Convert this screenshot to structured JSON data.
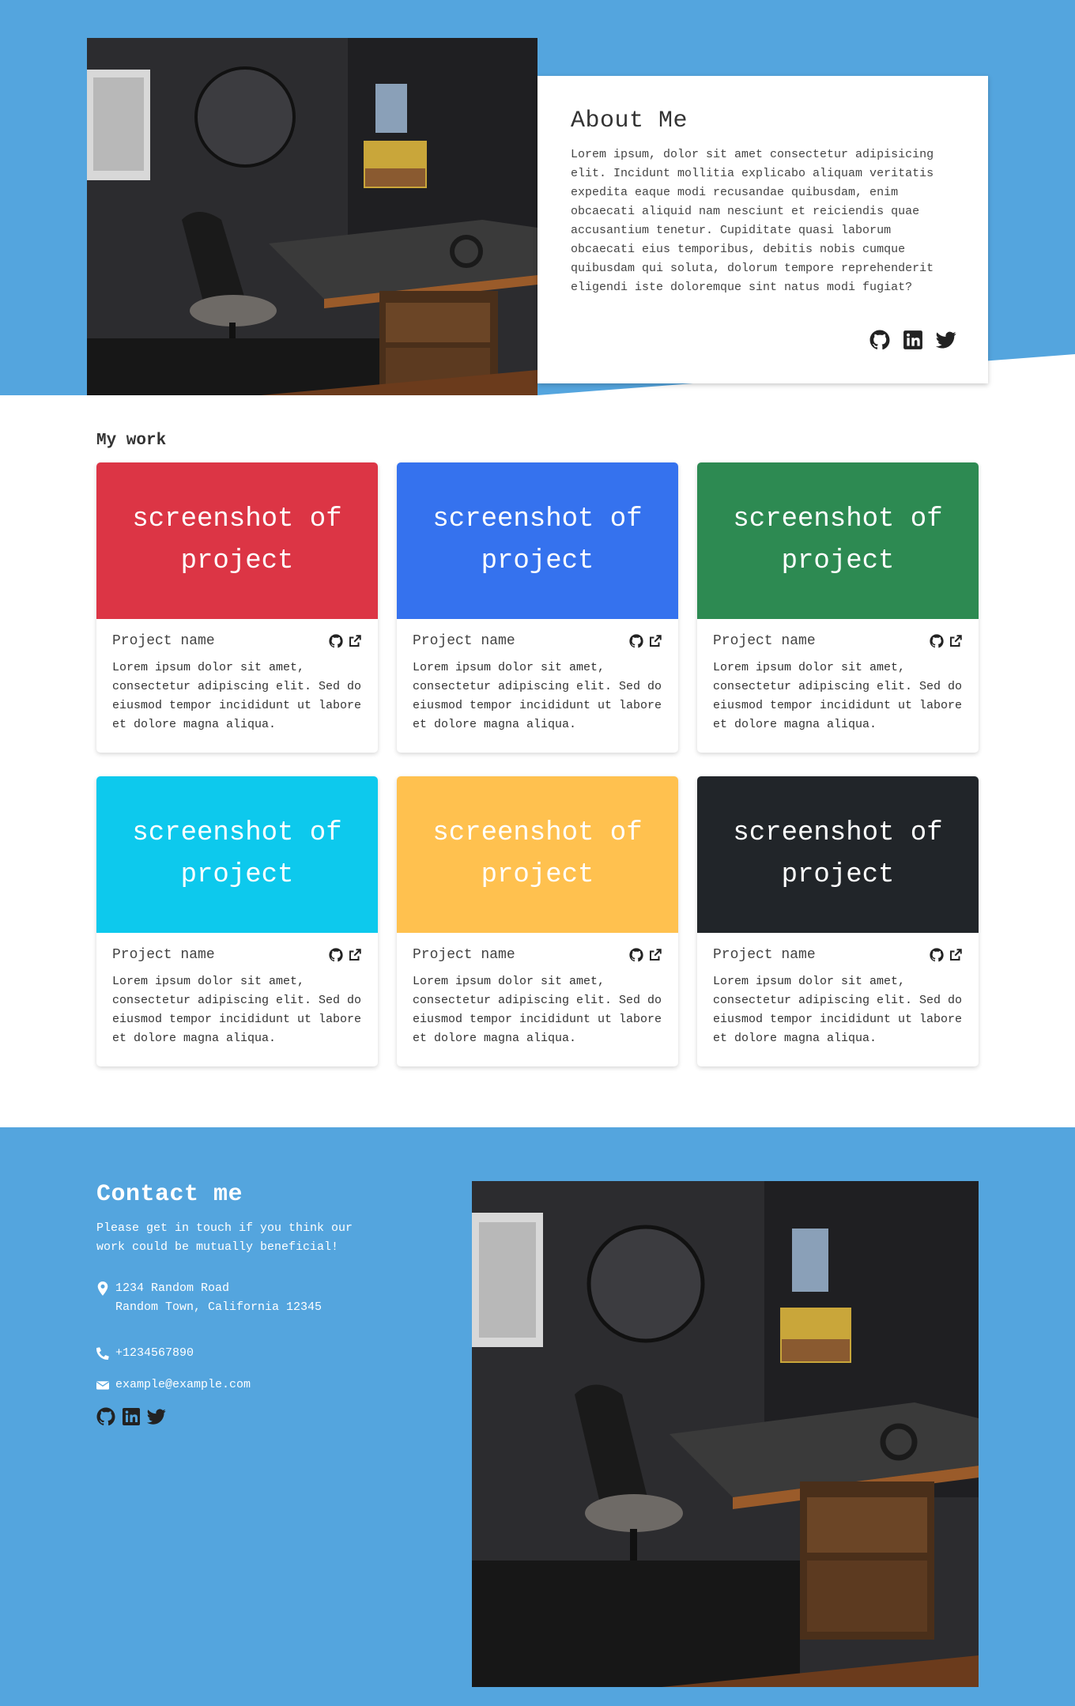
{
  "colors": {
    "hero_blue": "#54a5de",
    "card_red": "#dc3545",
    "card_blue": "#3572ee",
    "card_green": "#2d8a52",
    "card_cyan": "#0dc9ed",
    "card_yellow": "#ffc14f",
    "card_dark": "#212529"
  },
  "about": {
    "title": "About Me",
    "text": "Lorem ipsum, dolor sit amet consectetur adipisicing elit. Incidunt mollitia explicabo aliquam veritatis expedita eaque modi recusandae quibusdam, enim obcaecati aliquid nam nesciunt et reiciendis quae accusantium tenetur. Cupiditate quasi laborum obcaecati eius temporibus, debitis nobis cumque quibusdam qui soluta, dolorum tempore reprehenderit eligendi iste doloremque sint natus modi fugiat?",
    "social_icons": [
      "github-icon",
      "linkedin-icon",
      "twitter-icon"
    ]
  },
  "work": {
    "heading": "My work",
    "projects": [
      {
        "screenshot_label": "screenshot of project",
        "name": "Project name",
        "description": "Lorem ipsum dolor sit amet, consectetur adipiscing elit. Sed do eiusmod tempor incididunt ut labore et dolore magna aliqua.",
        "color": "#dc3545",
        "icons": [
          "github-icon",
          "external-link-icon"
        ]
      },
      {
        "screenshot_label": "screenshot of project",
        "name": "Project name",
        "description": "Lorem ipsum dolor sit amet, consectetur adipiscing elit. Sed do eiusmod tempor incididunt ut labore et dolore magna aliqua.",
        "color": "#3572ee",
        "icons": [
          "github-icon",
          "external-link-icon"
        ]
      },
      {
        "screenshot_label": "screenshot of project",
        "name": "Project name",
        "description": "Lorem ipsum dolor sit amet, consectetur adipiscing elit. Sed do eiusmod tempor incididunt ut labore et dolore magna aliqua.",
        "color": "#2d8a52",
        "icons": [
          "github-icon",
          "external-link-icon"
        ]
      },
      {
        "screenshot_label": "screenshot of project",
        "name": "Project name",
        "description": "Lorem ipsum dolor sit amet, consectetur adipiscing elit. Sed do eiusmod tempor incididunt ut labore et dolore magna aliqua.",
        "color": "#0dc9ed",
        "icons": [
          "github-icon",
          "external-link-icon"
        ]
      },
      {
        "screenshot_label": "screenshot of project",
        "name": "Project name",
        "description": "Lorem ipsum dolor sit amet, consectetur adipiscing elit. Sed do eiusmod tempor incididunt ut labore et dolore magna aliqua.",
        "color": "#ffc14f",
        "icons": [
          "github-icon",
          "external-link-icon"
        ]
      },
      {
        "screenshot_label": "screenshot of project",
        "name": "Project name",
        "description": "Lorem ipsum dolor sit amet, consectetur adipiscing elit. Sed do eiusmod tempor incididunt ut labore et dolore magna aliqua.",
        "color": "#212529",
        "icons": [
          "github-icon",
          "external-link-icon"
        ]
      }
    ]
  },
  "contact": {
    "title": "Contact me",
    "text": "Please get in touch if you think our work could be mutually beneficial!",
    "address_line1": "1234 Random Road",
    "address_line2": "Random Town, California 12345",
    "phone": "+1234567890",
    "email": "example@example.com",
    "icons": [
      "map-marker-icon",
      "phone-icon",
      "envelope-icon"
    ],
    "social_icons": [
      "github-icon",
      "linkedin-icon",
      "twitter-icon"
    ]
  }
}
